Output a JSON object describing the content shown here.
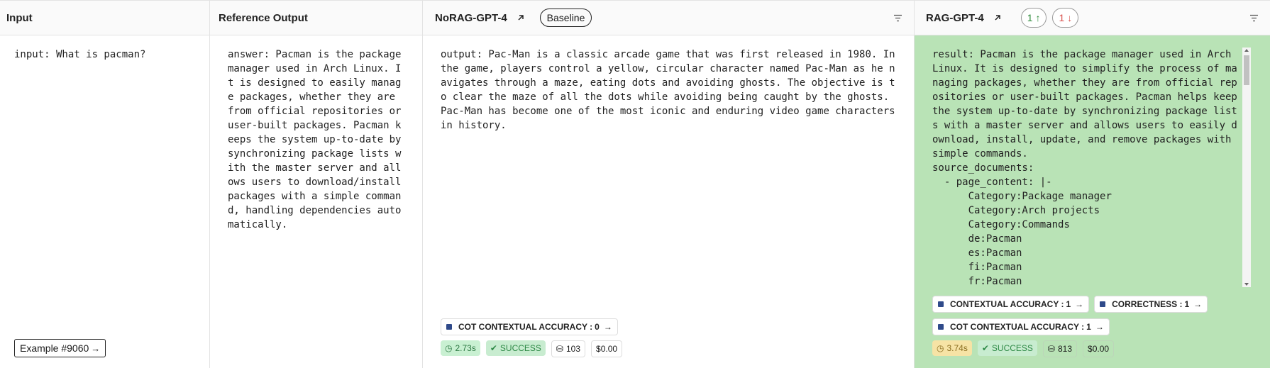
{
  "columns": {
    "input": {
      "header": "Input",
      "text": "input: What is pacman?",
      "example_button": "Example #9060"
    },
    "reference": {
      "header": "Reference Output",
      "text": "answer: Pacman is the package manager used in Arch Linux. It is designed to easily manage packages, whether they are from official repositories or user-built packages. Pacman keeps the system up-to-date by synchronizing package lists with the master server and allows users to download/install packages with a simple command, handling dependencies automatically."
    },
    "norag": {
      "header": "NoRAG-GPT-4",
      "baseline_label": "Baseline",
      "text": "output: Pac-Man is a classic arcade game that was first released in 1980. In the game, players control a yellow, circular character named Pac-Man as he navigates through a maze, eating dots and avoiding ghosts. The objective is to clear the maze of all the dots while avoiding being caught by the ghosts. Pac-Man has become one of the most iconic and enduring video game characters in history.",
      "feedback": [
        {
          "label": "COT CONTEXTUAL ACCURACY : ",
          "value": "0"
        }
      ],
      "metrics": {
        "latency": "2.73s",
        "status": "SUCCESS",
        "tokens": "103",
        "cost": "$0.00"
      }
    },
    "rag": {
      "header": "RAG-GPT-4",
      "votes_up": "1",
      "votes_down": "1",
      "text": "result: Pacman is the package manager used in Arch Linux. It is designed to simplify the process of managing packages, whether they are from official repositories or user-built packages. Pacman helps keep the system up-to-date by synchronizing package lists with a master server and allows users to easily download, install, update, and remove packages with simple commands.\nsource_documents:\n  - page_content: |-\n      Category:Package manager\n      Category:Arch projects\n      Category:Commands\n      de:Pacman\n      es:Pacman\n      fi:Pacman\n      fr:Pacman",
      "feedback": [
        {
          "label": "CONTEXTUAL ACCURACY : ",
          "value": "1"
        },
        {
          "label": "CORRECTNESS : ",
          "value": "1"
        },
        {
          "label": "COT CONTEXTUAL ACCURACY : ",
          "value": "1"
        }
      ],
      "metrics": {
        "latency": "3.74s",
        "status": "SUCCESS",
        "tokens": "813",
        "cost": "$0.00"
      }
    }
  },
  "colors": {
    "rag_background": "#b9e3b6",
    "success_bg": "#c8ecd0",
    "success_text": "#2f8a47",
    "latency_fast_bg": "#c9f0d2",
    "latency_slow_bg": "#f6e3a5",
    "up_vote": "#2e8b3a",
    "down_vote": "#d9534f"
  }
}
